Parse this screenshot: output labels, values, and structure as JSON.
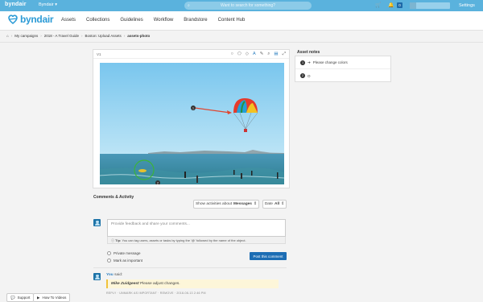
{
  "topbar": {
    "logo": "byndair",
    "workspace": "Byndair",
    "workspace_chevron": "chevron-down-icon",
    "search_placeholder": "Want to search for something?",
    "cart_icon": "cart-icon",
    "bell_icon": "bell-icon",
    "badge_count": "0",
    "settings_label": "Settings"
  },
  "nav": {
    "brand": "byndair",
    "items": [
      "Assets",
      "Collections",
      "Guidelines",
      "Workflow",
      "Brandstore",
      "Content Hub"
    ]
  },
  "breadcrumb": {
    "items": [
      "My campaigns",
      "2018 - A Travel Guide",
      "Boston: Upload Assets"
    ],
    "current": "assets-photo"
  },
  "viewer": {
    "version": "V1",
    "tools": [
      "circle-tool-icon",
      "polygon-tool-icon",
      "shape-tool-icon",
      "text-tool-icon",
      "pen-tool-icon",
      "zoom-icon",
      "fit-icon",
      "fullscreen-icon"
    ],
    "markers": [
      "1",
      "2"
    ]
  },
  "comments": {
    "title": "Comments & Activity",
    "show_label": "Show activities about",
    "show_value": "Messages",
    "date_label": "Date",
    "date_value": "All",
    "placeholder": "Provide feedback and share your comments...",
    "tip_strong": "Tip:",
    "tip": "You can tag users, assets or tasks by typing the '@' followed by the name of the object.",
    "private_label": "Private message",
    "important_label": "Mark as important",
    "post_label": "Post this comment",
    "entry": {
      "author": "You",
      "verb": "said:",
      "quote_author": "Mike Zuidgeest",
      "quote_text": "Please adjust changes.",
      "actions": "REPLY · UNMARK AS IMPORTANT · REMOVE · 2018-08-13 2:46 PM"
    }
  },
  "notes": {
    "title": "Asset notes",
    "items": [
      {
        "num": "1",
        "text": "Please change colors"
      },
      {
        "num": "2",
        "text": "O"
      }
    ]
  },
  "bottom": {
    "support": "Support",
    "videos": "How To Videos"
  },
  "colors": {
    "topbar": "#5ab2dd",
    "brand": "#2c9bd6",
    "primary_button": "#1c6db4",
    "annotation_red": "#e0452f",
    "annotation_green": "#3bb43b"
  }
}
